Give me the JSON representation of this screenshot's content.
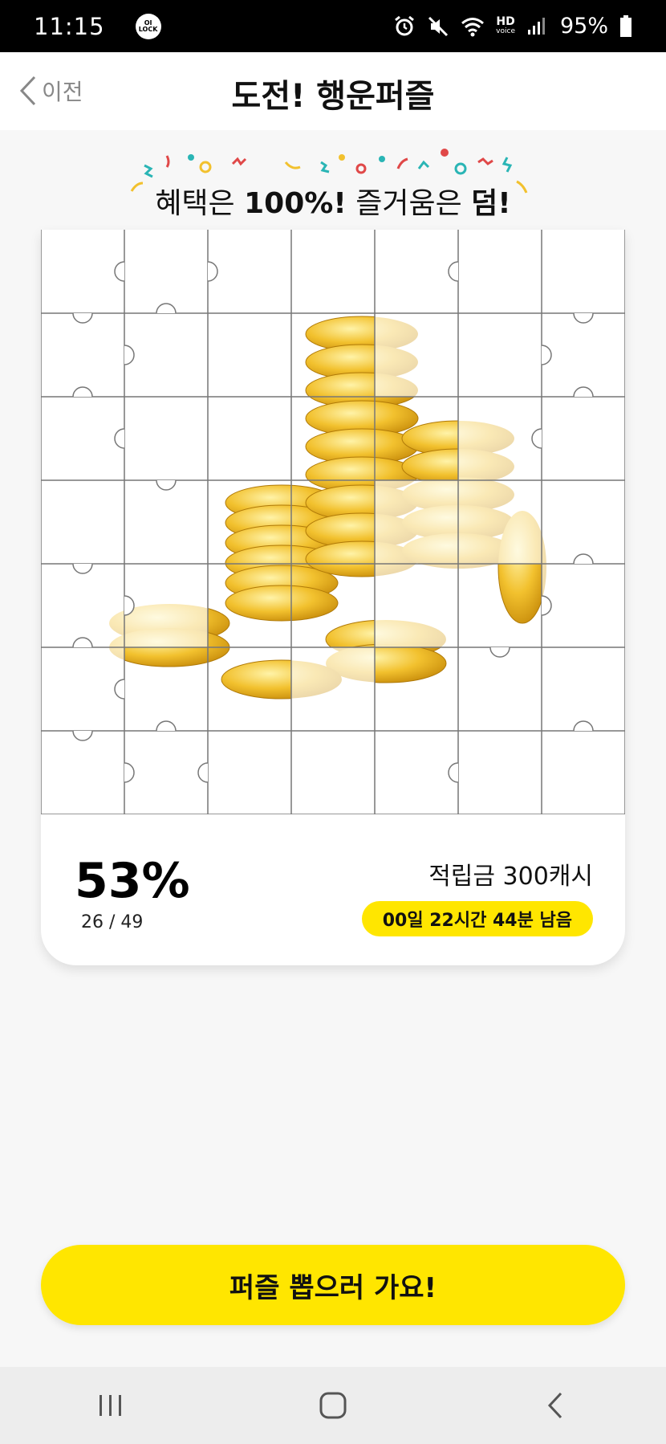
{
  "status_bar": {
    "time": "11:15",
    "app_badge_line1": "OI",
    "app_badge_line2": "LOCK",
    "hd_label": "HD",
    "voice_label": "voice",
    "battery": "95%"
  },
  "header": {
    "back_label": "이전",
    "title": "도전! 행운퍼즐"
  },
  "banner": {
    "text_part1": "혜택은 ",
    "text_bold1": "100%!",
    "text_part2": " 즐거움은 ",
    "text_bold2": "덤!"
  },
  "puzzle": {
    "grid_cols": 7,
    "grid_rows": 7,
    "image_subject": "gold-coins-stack",
    "coin_color": "#f2c12e"
  },
  "progress": {
    "percent": "53%",
    "count": "26 / 49",
    "reward": "적립금 300캐시",
    "time_left": "00일 22시간 44분 남음"
  },
  "cta": {
    "label": "퍼즐 뽑으러 가요!"
  },
  "colors": {
    "accent": "#ffe600",
    "background": "#f7f7f7"
  }
}
